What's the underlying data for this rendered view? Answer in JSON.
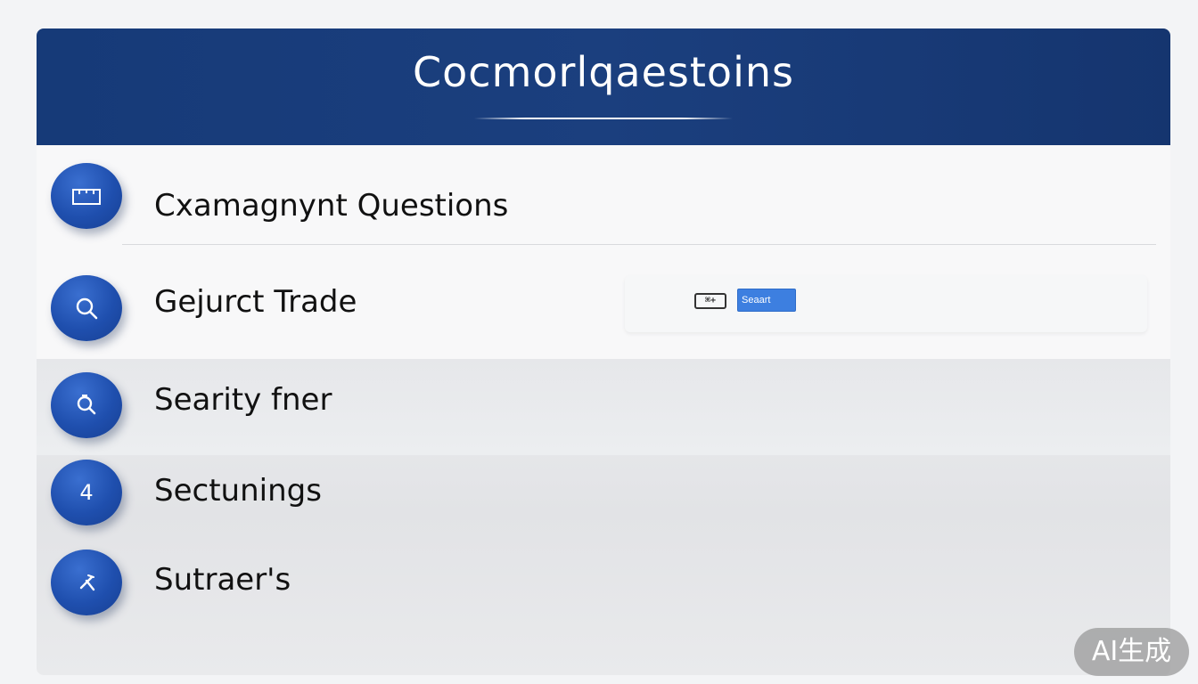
{
  "header": {
    "title": "Cocmorlqaestoins"
  },
  "items": [
    {
      "label": "Cxamagnynt Questions",
      "icon": "briefcase-icon"
    },
    {
      "label": "Gejurct Trade",
      "icon": "search-icon"
    },
    {
      "label": "Searity fner",
      "icon": "search-icon"
    },
    {
      "label": "Sectunings",
      "icon": "number-icon",
      "icon_text": "4"
    },
    {
      "label": "Sutraer's",
      "icon": "tools-icon"
    }
  ],
  "search": {
    "shortcut_label": "⌘+",
    "button_label": "Seaart"
  },
  "badge": {
    "text": "AI生成"
  },
  "colors": {
    "header_bg": "#1b3f7e",
    "icon_blue": "#1f4fae",
    "search_button": "#3d7fe0"
  }
}
